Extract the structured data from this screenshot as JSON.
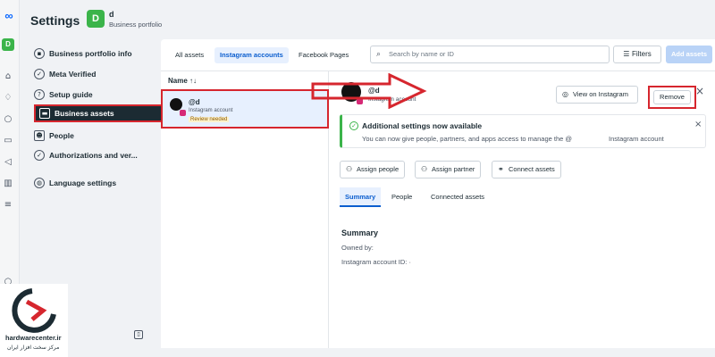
{
  "app": {
    "title": "Settings",
    "business": {
      "initial": "D",
      "name": "d",
      "subtitle": "Business portfolio"
    }
  },
  "rail": {
    "avatar_initial": "D",
    "icons": [
      "meta-logo-icon",
      "home-icon",
      "bell-icon",
      "chat-icon",
      "pages-icon",
      "megaphone-icon",
      "chart-icon",
      "menu-icon",
      "help-icon"
    ]
  },
  "nav": {
    "items": [
      {
        "label": "Business portfolio info",
        "icon": "briefcase-icon"
      },
      {
        "label": "Meta Verified",
        "icon": "verified-icon"
      },
      {
        "label": "Setup guide",
        "icon": "question-icon"
      },
      {
        "label": "Business assets",
        "icon": "assets-icon"
      },
      {
        "label": "People",
        "icon": "people-icon"
      },
      {
        "label": "Authorizations and ver...",
        "icon": "shield-check-icon"
      },
      {
        "label": "Language settings",
        "icon": "globe-icon"
      }
    ],
    "active": "Business assets"
  },
  "toolbar": {
    "tabs": [
      "All assets",
      "Instagram accounts",
      "Facebook Pages"
    ],
    "selected_tab": "Instagram accounts",
    "search_placeholder": "Search by name or ID",
    "filters_label": "Filters",
    "add_assets_label": "Add assets"
  },
  "list": {
    "column_header": "Name ↑↓",
    "rows": [
      {
        "name": "@d",
        "type": "Instagram account",
        "status": "Review needed"
      }
    ]
  },
  "detail": {
    "name": "@d",
    "type": "Instagram account",
    "view_button": "View on Instagram",
    "remove_button": "Remove",
    "banner": {
      "title": "Additional settings now available",
      "body": "You can now give people, partners, and apps access to manage the @",
      "body_tail": "Instagram account"
    },
    "actions": [
      "Assign people",
      "Assign partner",
      "Connect assets"
    ],
    "subtabs": [
      "Summary",
      "People",
      "Connected assets"
    ],
    "selected_subtab": "Summary",
    "summary": {
      "title": "Summary",
      "owned_by": "Owned by:",
      "account_id": "Instagram account ID: ·"
    }
  },
  "watermark": {
    "text": "hardwarecenter.ir",
    "text_fa": "مرکز سخت افزار ایران"
  },
  "colors": {
    "highlight": "#d6262e",
    "accent": "#0b5ecf",
    "business_avatar": "#3bb44a"
  }
}
